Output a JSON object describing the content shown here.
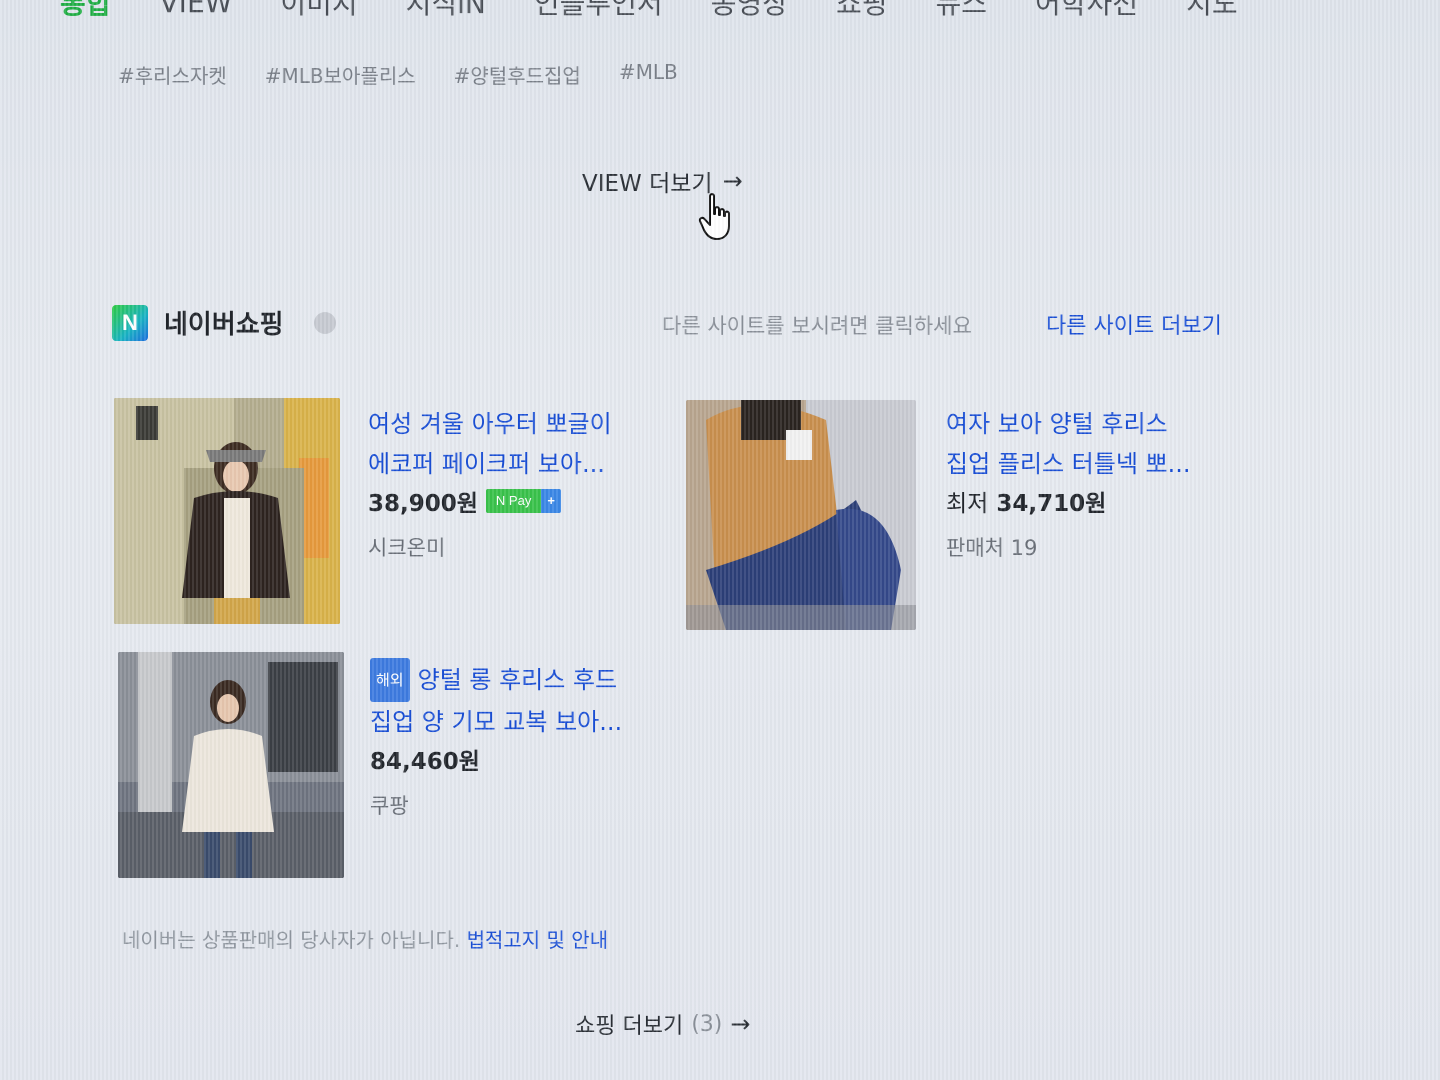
{
  "tabs": [
    {
      "label": "통합",
      "active": true
    },
    {
      "label": "VIEW"
    },
    {
      "label": "이미지"
    },
    {
      "label": "지식iN"
    },
    {
      "label": "인플루언서",
      "badge": true
    },
    {
      "label": "동영상"
    },
    {
      "label": "쇼핑"
    },
    {
      "label": "뉴스"
    },
    {
      "label": "어학사전"
    },
    {
      "label": "지도"
    }
  ],
  "tags": [
    "#후리스자켓",
    "#MLB보아플리스",
    "#양털후드집업",
    "#MLB"
  ],
  "view_more": {
    "label": "VIEW 더보기",
    "arrow": "→"
  },
  "shopping": {
    "logo_letter": "N",
    "title": "네이버쇼핑",
    "hint": "다른 사이트를 보시려면 클릭하세요",
    "other_link": "다른 사이트 더보기"
  },
  "products": [
    {
      "title_line1": "여성 겨울 아우터 뽀글이",
      "title_line2": "에코퍼 페이크퍼 보아...",
      "price": "38,900원",
      "store": "시크온미",
      "npay_left": "N Pay",
      "npay_right": "+"
    },
    {
      "title_line1": "여자 보아 양털 후리스",
      "title_line2": "집업 플리스 터틀넥 뽀...",
      "price_prefix": "최저",
      "price": "34,710원",
      "store": "판매처 19"
    },
    {
      "badge": "해외",
      "title_line1": "양털 롱 후리스 후드",
      "title_line2": "집업 양 기모 교복 보아...",
      "price": "84,460원",
      "store": "쿠팡"
    }
  ],
  "disclaimer": {
    "text": "네이버는 상품판매의 당사자가 아닙니다. ",
    "link": "법적고지 및 안내"
  },
  "shop_more": {
    "label": "쇼핑 더보기",
    "count": "(3)",
    "arrow": "→"
  }
}
